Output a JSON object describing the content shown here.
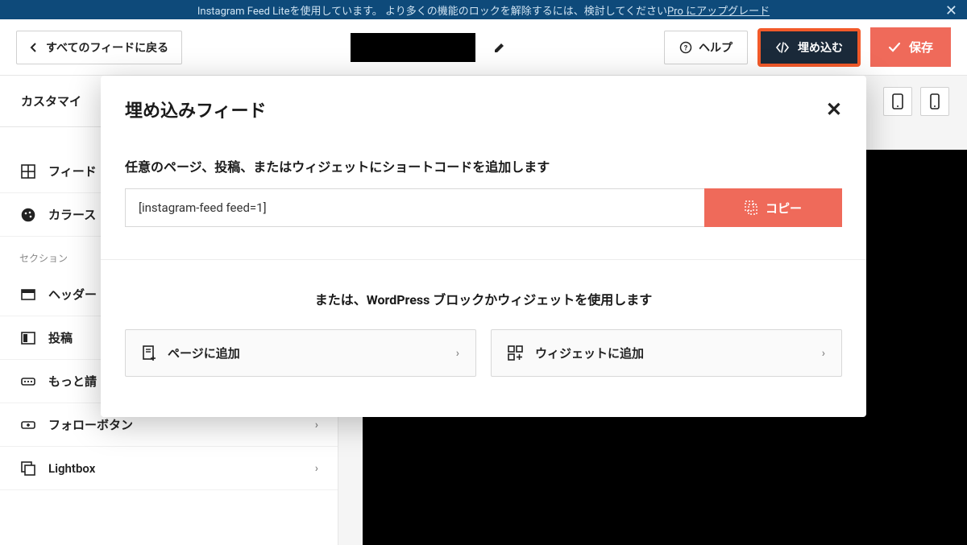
{
  "promo": {
    "text_prefix": "Instagram Feed Liteを使用しています。 より多くの機能のロックを解除するには、検討してください ",
    "link_text": "Pro にアップグレード"
  },
  "toolbar": {
    "back_label": "すべてのフィードに戻る",
    "help_label": "ヘルプ",
    "embed_label": "埋め込む",
    "save_label": "保存"
  },
  "sidebar": {
    "tab_label": "カスタマイ",
    "items_top": [
      {
        "label": "フィード",
        "icon": "grid"
      },
      {
        "label": "カラース",
        "icon": "palette"
      }
    ],
    "section_label": "セクション",
    "items_section": [
      {
        "label": "ヘッダー",
        "icon": "header"
      },
      {
        "label": "投稿",
        "icon": "post"
      },
      {
        "label": "もっと請",
        "icon": "more"
      },
      {
        "label": "フォローボタン",
        "icon": "follow"
      },
      {
        "label": "Lightbox",
        "icon": "lightbox"
      }
    ]
  },
  "modal": {
    "title": "埋め込みフィード",
    "shortcode_heading": "任意のページ、投稿、またはウィジェットにショートコードを追加します",
    "shortcode_value": "[instagram-feed feed=1]",
    "copy_label": "コピー",
    "alt_heading": "または、WordPress ブロックかウィジェットを使用します",
    "add_page_label": "ページに追加",
    "add_widget_label": "ウィジェットに追加"
  }
}
